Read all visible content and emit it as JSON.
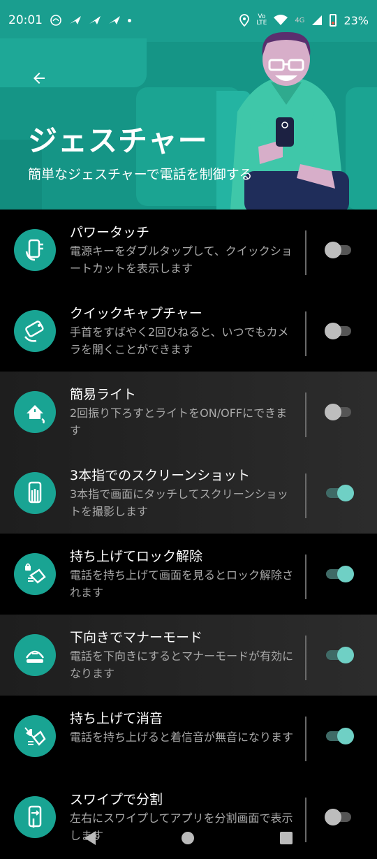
{
  "status_bar": {
    "time": "20:01",
    "network_top": "Vo",
    "network_bottom": "LTE",
    "signal_type": "4G",
    "battery": "23%"
  },
  "header": {
    "title": "ジェスチャー",
    "subtitle": "簡単なジェスチャーで電話を制御する",
    "back_icon": "arrow-back-icon",
    "accent_color": "#1a9e8f"
  },
  "items": [
    {
      "title": "パワータッチ",
      "desc": "電源キーをダブルタップして、クイックショートカットを表示します",
      "enabled": false,
      "icon": "power-touch-icon"
    },
    {
      "title": "クイックキャプチャー",
      "desc": "手首をすばやく2回ひねると、いつでもカメラを開くことができます",
      "enabled": false,
      "icon": "quick-capture-icon"
    },
    {
      "title": "簡易ライト",
      "desc": "2回振り下ろすとライトをON/OFFにできます",
      "enabled": false,
      "icon": "flashlight-chop-icon"
    },
    {
      "title": "3本指でのスクリーンショット",
      "desc": "3本指で画面にタッチしてスクリーンショットを撮影します",
      "enabled": true,
      "icon": "three-finger-screenshot-icon"
    },
    {
      "title": "持ち上げてロック解除",
      "desc": "電話を持ち上げて画面を見るとロック解除されます",
      "enabled": true,
      "icon": "lift-unlock-icon"
    },
    {
      "title": "下向きでマナーモード",
      "desc": "電話を下向きにするとマナーモードが有効になります",
      "enabled": true,
      "icon": "flip-silent-icon"
    },
    {
      "title": "持ち上げて消音",
      "desc": "電話を持ち上げると着信音が無音になります",
      "enabled": true,
      "icon": "lift-mute-icon"
    },
    {
      "title": "スワイプで分割",
      "desc": "左右にスワイプしてアプリを分割画面で表示します",
      "enabled": false,
      "icon": "swipe-split-icon"
    }
  ],
  "colors": {
    "toggle_on_thumb": "#6fd0c5",
    "toggle_off_thumb": "#bdbdbd",
    "icon_bg": "#19a493"
  }
}
